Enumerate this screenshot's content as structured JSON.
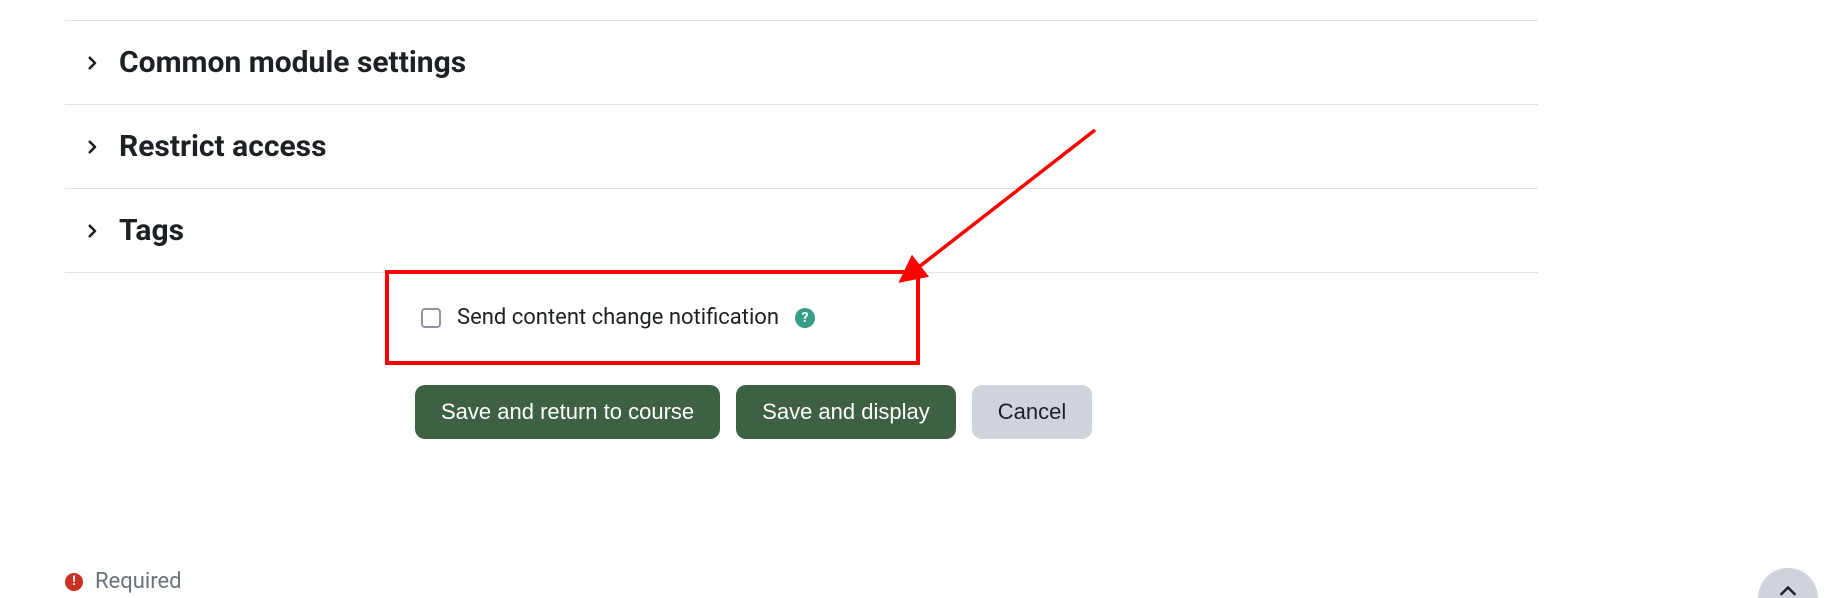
{
  "sections": [
    {
      "title": "Common module settings"
    },
    {
      "title": "Restrict access"
    },
    {
      "title": "Tags"
    }
  ],
  "checkbox": {
    "label": "Send content change notification"
  },
  "buttons": {
    "save_return": "Save and return to course",
    "save_display": "Save and display",
    "cancel": "Cancel"
  },
  "required_label": "Required",
  "annotation": {
    "highlight_color": "#ff0000",
    "arrow_color": "#ff0000"
  }
}
